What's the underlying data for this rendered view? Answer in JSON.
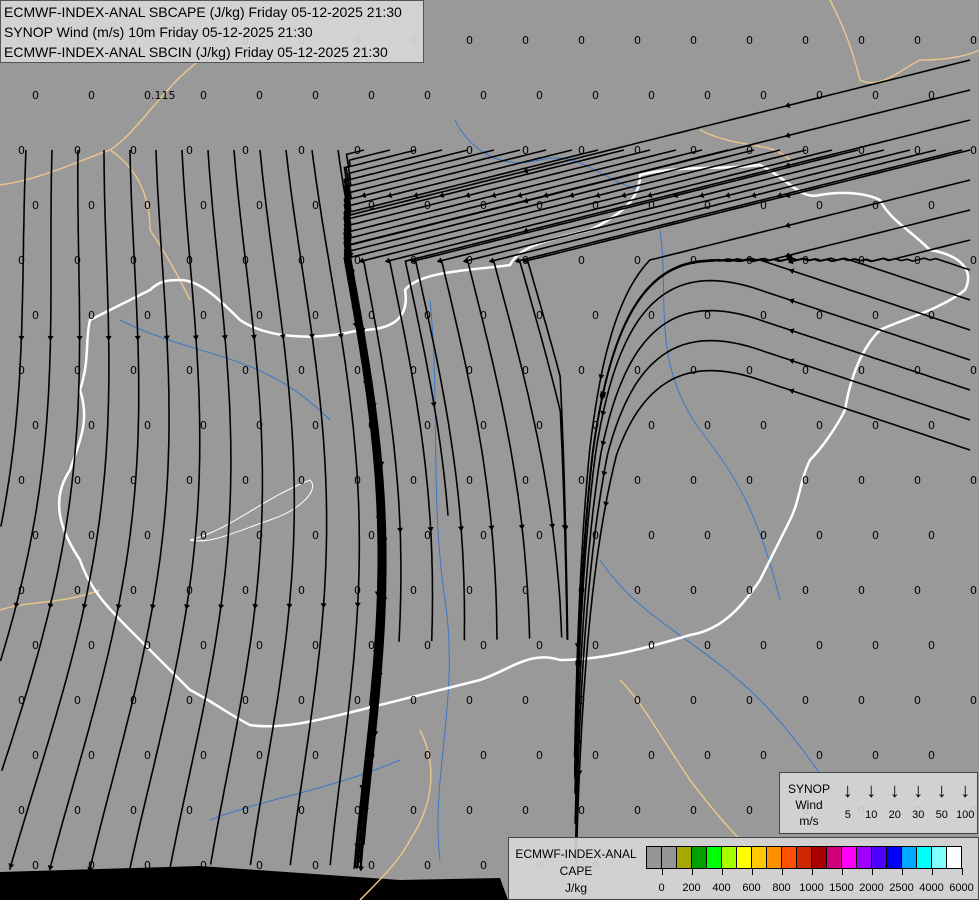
{
  "title_box": {
    "lines": [
      "ECMWF-INDEX-ANAL SBCAPE (J/kg) Friday 05-12-2025 21:30",
      "SYNOP Wind (m/s) 10m Friday 05-12-2025 21:30",
      "ECMWF-INDEX-ANAL SBCIN (J/kg) Friday 05-12-2025 21:30"
    ]
  },
  "map": {
    "background_color": "#999999",
    "streamline_color": "#000000",
    "national_border_color": "#ffffff",
    "other_border_color": "#e8c48c",
    "river_color": "#3a78c8",
    "value_rows": [
      [
        "0",
        "0",
        "0",
        "0",
        "0",
        "0",
        "0",
        "0",
        "0",
        "0",
        "0",
        "0",
        "0",
        "0",
        "0",
        "0",
        "0",
        "0"
      ],
      [
        "0",
        "0",
        "0.115",
        "0",
        "0",
        "0",
        "0",
        "0",
        "0",
        "0",
        "0",
        "0",
        "0",
        "0",
        "0",
        "0",
        "0",
        "0"
      ],
      [
        "0",
        "0",
        "0",
        "0",
        "0",
        "0",
        "0",
        "0",
        "0",
        "0",
        "0",
        "0",
        "0",
        "0",
        "0",
        "0",
        "0",
        "0"
      ],
      [
        "0",
        "0",
        "0",
        "0",
        "0",
        "0",
        "0",
        "0",
        "0",
        "0",
        "0",
        "0",
        "0",
        "0",
        "0",
        "0",
        "0",
        "0"
      ],
      [
        "0",
        "0",
        "0",
        "0",
        "0",
        "0",
        "0",
        "0",
        "0",
        "0",
        "0",
        "0",
        "0",
        "0",
        "0",
        "0",
        "0",
        "0"
      ],
      [
        "0",
        "0",
        "0",
        "0",
        "0",
        "0",
        "0",
        "0",
        "0",
        "0",
        "0",
        "0",
        "0",
        "0",
        "0",
        "0",
        "0",
        "0"
      ],
      [
        "0",
        "0",
        "0",
        "0",
        "0",
        "0",
        "0",
        "0",
        "0",
        "0",
        "0",
        "0",
        "0",
        "0",
        "0",
        "0",
        "0",
        "0"
      ],
      [
        "0",
        "0",
        "0",
        "0",
        "0",
        "0",
        "0",
        "0",
        "0",
        "0",
        "0",
        "0",
        "0",
        "0",
        "0",
        "0",
        "0",
        "0"
      ],
      [
        "0",
        "0",
        "0",
        "0",
        "0",
        "0",
        "0",
        "0",
        "0",
        "0",
        "0",
        "0",
        "0",
        "0",
        "0",
        "0",
        "0",
        "0"
      ],
      [
        "0",
        "0",
        "0",
        "0",
        "0",
        "0",
        "0",
        "0",
        "0",
        "0",
        "0",
        "0",
        "0",
        "0",
        "0",
        "0",
        "0",
        "0"
      ],
      [
        "0",
        "0",
        "0",
        "0",
        "0",
        "0",
        "0",
        "0",
        "0",
        "0",
        "0",
        "0",
        "0",
        "0",
        "0",
        "0",
        "0",
        "0"
      ],
      [
        "0",
        "0",
        "0",
        "0",
        "0",
        "0",
        "0",
        "0",
        "0",
        "0",
        "0",
        "0",
        "0",
        "0",
        "0",
        "0",
        "0",
        "0"
      ],
      [
        "0",
        "0",
        "0",
        "0",
        "0",
        "0",
        "0",
        "0",
        "0",
        "0",
        "0",
        "0",
        "0",
        "0",
        "0",
        "0",
        "0",
        "0"
      ],
      [
        "0",
        "0",
        "0",
        "0",
        "0",
        "0",
        "0",
        "0",
        "0",
        "0",
        "0",
        "0",
        "0",
        "0",
        "0",
        "0",
        "0",
        "0"
      ],
      [
        "0",
        "0",
        "0",
        "0",
        "0",
        "0",
        "0",
        "0",
        "0",
        "0",
        "0",
        "0",
        "0",
        "0",
        "0",
        "0",
        "0",
        "0"
      ],
      [
        "0",
        "0",
        "0",
        "0",
        "0",
        "0",
        "0",
        "0",
        "0",
        "0",
        "0",
        "0",
        "0",
        "0",
        "0",
        "0",
        "0",
        "0"
      ]
    ]
  },
  "synop_legend": {
    "label_lines": [
      "SYNOP",
      "Wind",
      "m/s"
    ],
    "arrow_icon": "down-arrow",
    "speeds": [
      "5",
      "10",
      "20",
      "30",
      "50",
      "100"
    ]
  },
  "cape_legend": {
    "label_lines": [
      "ECMWF-INDEX-ANAL",
      "CAPE",
      "J/kg"
    ],
    "colors": [
      "#969696",
      "#969696",
      "#a8a800",
      "#00a000",
      "#00ff00",
      "#a8ff00",
      "#ffff00",
      "#ffc800",
      "#ff9000",
      "#ff5000",
      "#d02800",
      "#a80000",
      "#d0007c",
      "#ff00ff",
      "#a000ff",
      "#5000ff",
      "#0000ff",
      "#00a8ff",
      "#00ffff",
      "#80ffff",
      "#ffffff"
    ],
    "tick_labels": [
      "0",
      "200",
      "400",
      "600",
      "800",
      "1000",
      "1500",
      "2000",
      "2500",
      "4000",
      "6000"
    ]
  }
}
